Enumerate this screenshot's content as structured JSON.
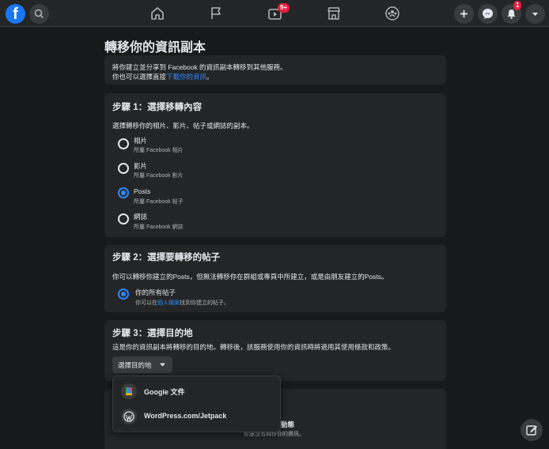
{
  "nav": {
    "video_badge": "9+",
    "notif_badge": "1"
  },
  "page_title": "轉移你的資訊副本",
  "intro": {
    "line1": "將你建立並分享到 Facebook 的資訊副本轉移到其他服務。",
    "line2_prefix": "你也可以選擇直接",
    "line2_link": "下載你的資訊",
    "line2_suffix": "。"
  },
  "step1": {
    "title": "步驟 1：選擇移轉內容",
    "description": "選擇轉移你的相片、影片、帖子或網誌的副本。",
    "options": [
      {
        "label": "相片",
        "sub": "所屬 Facebook 相片",
        "selected": false
      },
      {
        "label": "影片",
        "sub": "所屬 Facebook 影片",
        "selected": false
      },
      {
        "label": "Posts",
        "sub": "所屬 Facebook 帖子",
        "selected": true
      },
      {
        "label": "網誌",
        "sub": "所屬 Facebook 網誌",
        "selected": false
      }
    ]
  },
  "step2": {
    "title": "步驟 2：選擇要轉移的帖子",
    "description": "你可以轉移你建立的Posts，但無法轉移你在群組或專頁中所建立，或是由朋友建立的Posts。",
    "option_label": "你的所有帖子",
    "option_sub_prefix": "你可以在",
    "option_sub_link": "個人檔案",
    "option_sub_suffix": "找到你建立的帖子。"
  },
  "step3": {
    "title": "步驟 3：選擇目的地",
    "description": "這是你的資訊副本將轉移的目的地。轉移後，該服務使用你的資訊時將適用其使用條款和政策。",
    "dropdown_label": "選擇目的地",
    "menu": [
      {
        "label": "Google 文件",
        "icon": "google-docs-icon"
      },
      {
        "label": "WordPress.com/Jetpack",
        "icon": "wordpress-icon"
      }
    ]
  },
  "step4_partial": {
    "title_tail": "動態",
    "sub_tail": "你還沒有轉移你的資訊。"
  }
}
